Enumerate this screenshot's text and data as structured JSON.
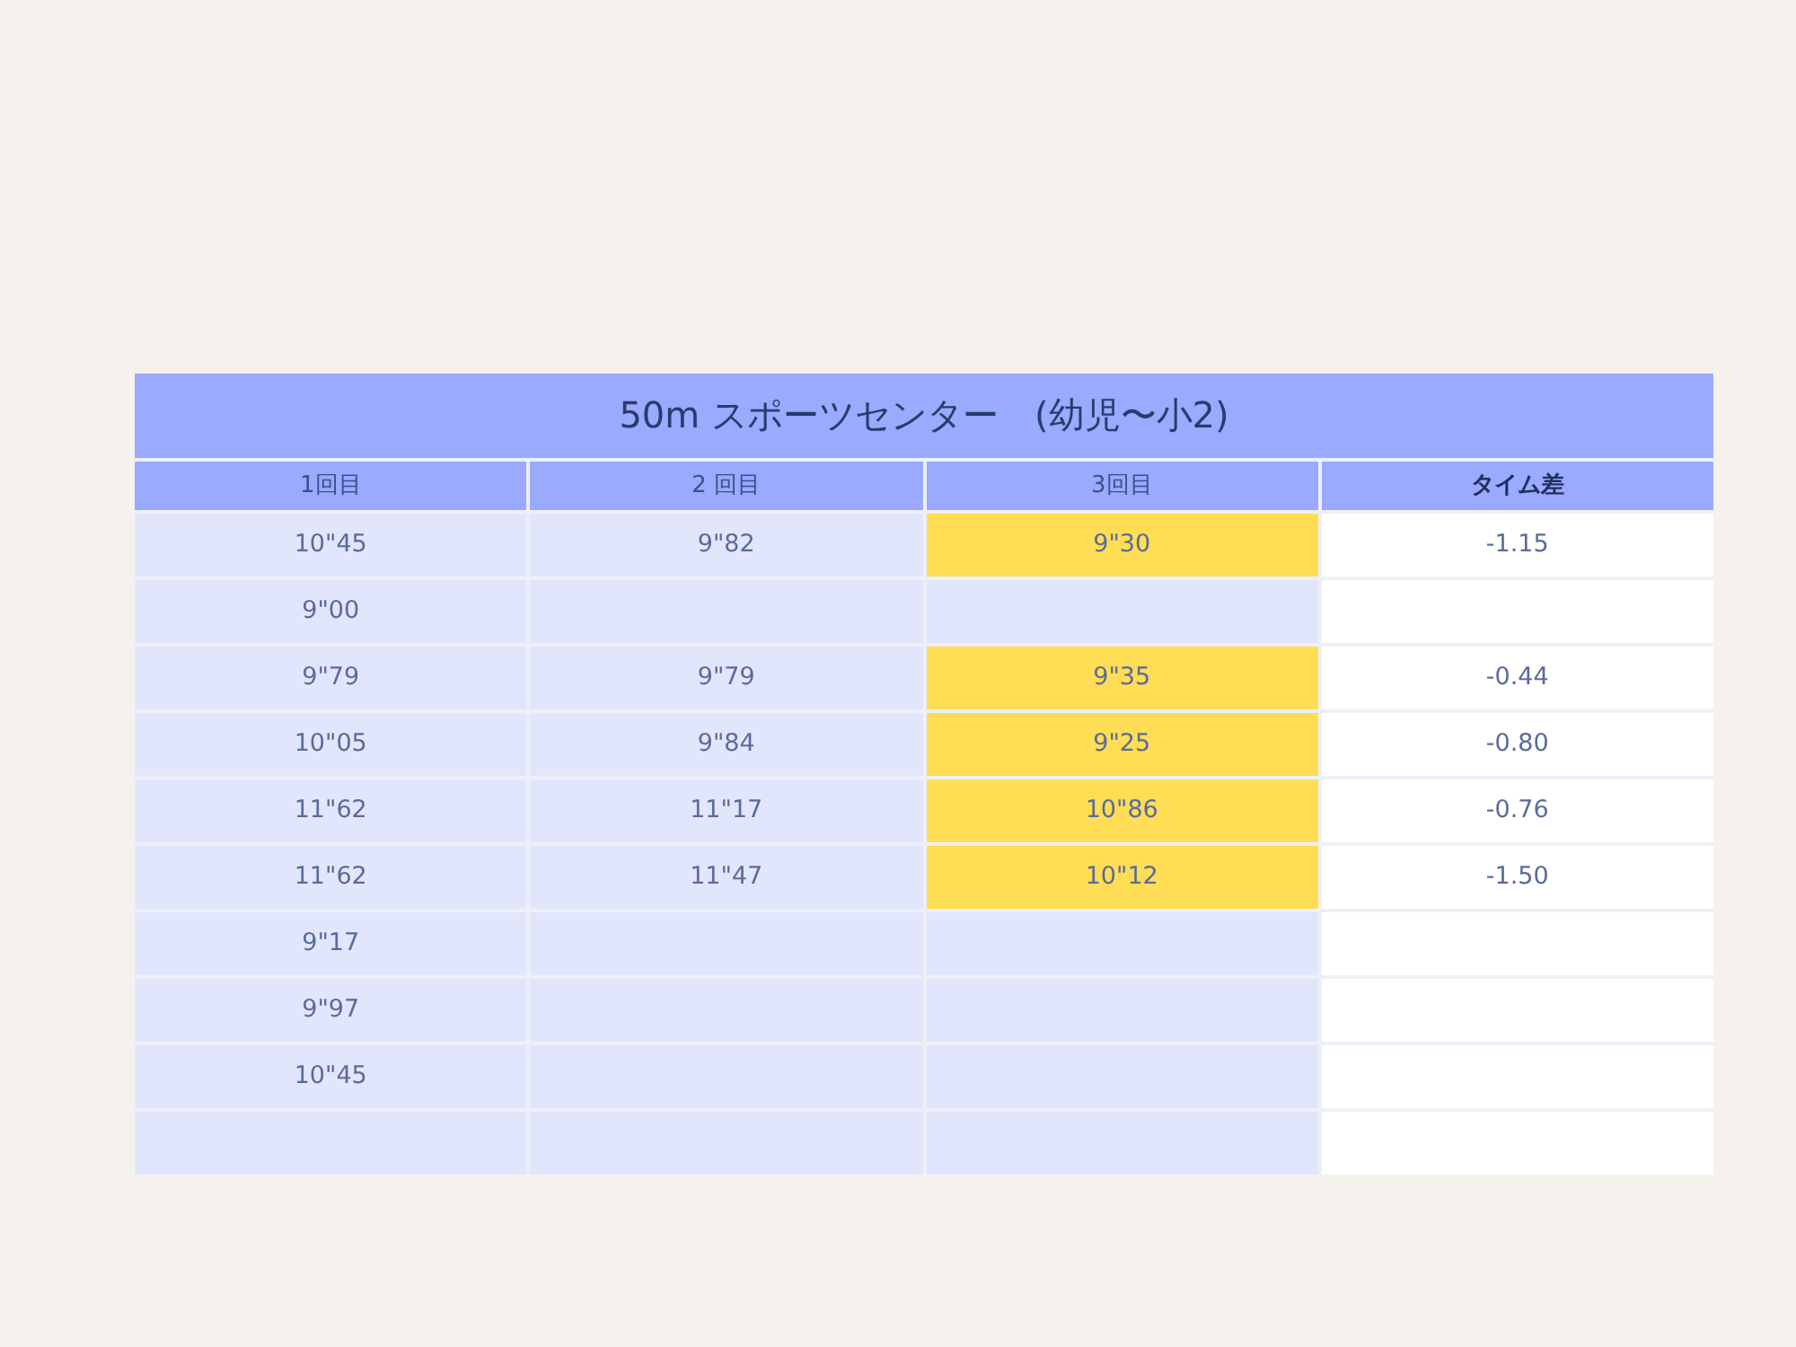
{
  "table": {
    "title": "50m スポーツセンター　(幼児〜小2)",
    "columns": [
      {
        "label": "1回目",
        "bold": false
      },
      {
        "label": "2 回目",
        "bold": false
      },
      {
        "label": "3回目",
        "bold": false
      },
      {
        "label": "タイム差",
        "bold": true
      }
    ],
    "rows": [
      {
        "cells": [
          {
            "text": "10\"45",
            "highlighted": false
          },
          {
            "text": "9\"82",
            "highlighted": false
          },
          {
            "text": "9\"30",
            "highlighted": true
          },
          {
            "text": "-1.15",
            "highlighted": false
          }
        ]
      },
      {
        "cells": [
          {
            "text": "9\"00",
            "highlighted": false
          },
          {
            "highlighted": false
          },
          {
            "highlighted": false
          },
          {
            "highlighted": false
          }
        ]
      },
      {
        "cells": [
          {
            "text": "9\"79",
            "highlighted": false
          },
          {
            "text": "9\"79",
            "highlighted": false
          },
          {
            "text": "9\"35",
            "highlighted": true
          },
          {
            "text": "-0.44",
            "highlighted": false
          }
        ]
      },
      {
        "cells": [
          {
            "text": "10\"05",
            "highlighted": false
          },
          {
            "text": "9\"84",
            "highlighted": false
          },
          {
            "text": "9\"25",
            "highlighted": true
          },
          {
            "text": "-0.80",
            "highlighted": false
          }
        ]
      },
      {
        "cells": [
          {
            "text": "11\"62",
            "highlighted": false
          },
          {
            "text": "11\"17",
            "highlighted": false
          },
          {
            "text": "10\"86",
            "highlighted": true
          },
          {
            "text": "-0.76",
            "highlighted": false
          }
        ]
      },
      {
        "cells": [
          {
            "text": "11\"62",
            "highlighted": false
          },
          {
            "text": "11\"47",
            "highlighted": false
          },
          {
            "text": "10\"12",
            "highlighted": true
          },
          {
            "text": "-1.50",
            "highlighted": false
          }
        ]
      },
      {
        "cells": [
          {
            "text": "9\"17",
            "highlighted": false
          },
          {
            "highlighted": false
          },
          {
            "highlighted": false
          },
          {
            "highlighted": false
          }
        ]
      },
      {
        "cells": [
          {
            "text": "9\"97",
            "highlighted": false
          },
          {
            "highlighted": false
          },
          {
            "highlighted": false
          },
          {
            "highlighted": false
          }
        ]
      },
      {
        "cells": [
          {
            "text": "10\"45",
            "highlighted": false
          },
          {
            "highlighted": false
          },
          {
            "highlighted": false
          },
          {
            "highlighted": false
          }
        ]
      },
      {
        "cells": [
          {
            "highlighted": false
          },
          {
            "highlighted": false
          },
          {
            "highlighted": false
          },
          {
            "highlighted": false
          }
        ]
      }
    ]
  }
}
